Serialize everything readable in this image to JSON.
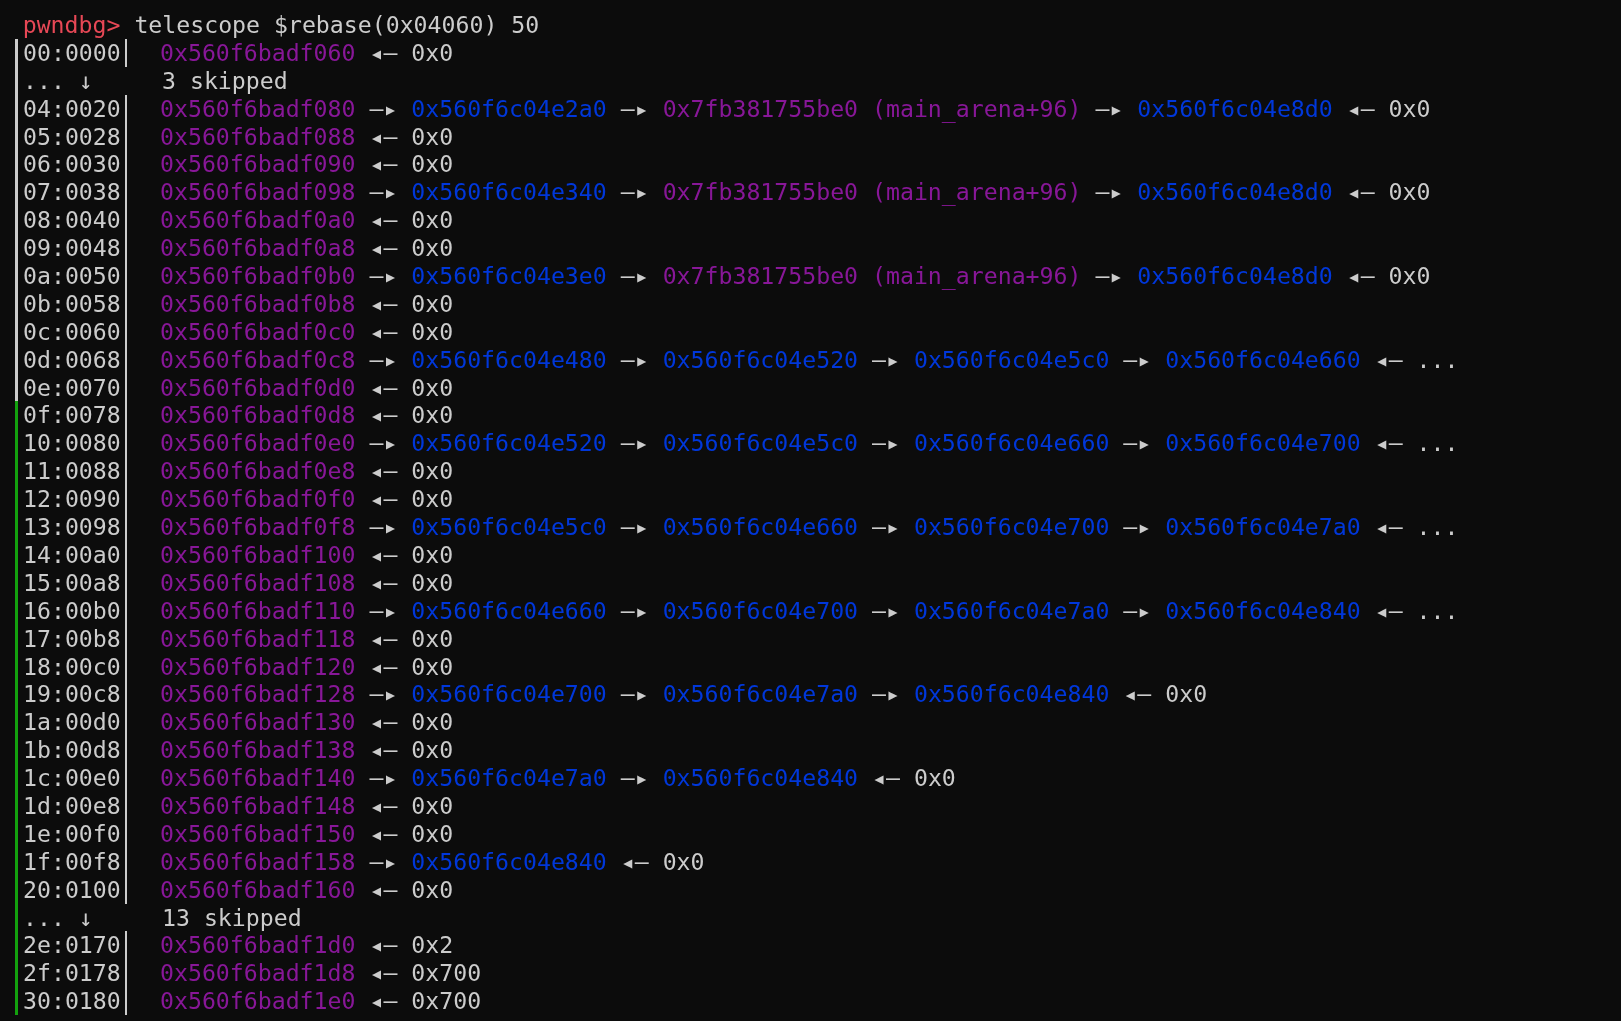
{
  "prompt": {
    "label": "pwndbg>",
    "command": "telescope $rebase(0x04060) 50"
  },
  "rows": [
    {
      "kind": "entry",
      "color": "#cccccc",
      "index": "00:0000",
      "chain": [
        {
          "text": "0x560f6badf060",
          "kind": "address"
        },
        {
          "text": "◂—",
          "kind": "arrow"
        },
        {
          "text": "0x0",
          "kind": "value"
        }
      ]
    },
    {
      "kind": "skip",
      "color": "#cccccc",
      "marker": "... ↓",
      "text": "3 skipped"
    },
    {
      "kind": "entry",
      "color": "#cccccc",
      "index": "04:0020",
      "chain": [
        {
          "text": "0x560f6badf080",
          "kind": "address"
        },
        {
          "text": "—▸",
          "kind": "arrow"
        },
        {
          "text": "0x560f6c04e2a0",
          "kind": "heap"
        },
        {
          "text": "—▸",
          "kind": "arrow"
        },
        {
          "text": "0x7fb381755be0 (main_arena+96)",
          "kind": "libc"
        },
        {
          "text": "—▸",
          "kind": "arrow"
        },
        {
          "text": "0x560f6c04e8d0",
          "kind": "heap"
        },
        {
          "text": "◂—",
          "kind": "arrow"
        },
        {
          "text": "0x0",
          "kind": "value"
        }
      ]
    },
    {
      "kind": "entry",
      "color": "#cccccc",
      "index": "05:0028",
      "chain": [
        {
          "text": "0x560f6badf088",
          "kind": "address"
        },
        {
          "text": "◂—",
          "kind": "arrow"
        },
        {
          "text": "0x0",
          "kind": "value"
        }
      ]
    },
    {
      "kind": "entry",
      "color": "#cccccc",
      "index": "06:0030",
      "chain": [
        {
          "text": "0x560f6badf090",
          "kind": "address"
        },
        {
          "text": "◂—",
          "kind": "arrow"
        },
        {
          "text": "0x0",
          "kind": "value"
        }
      ]
    },
    {
      "kind": "entry",
      "color": "#cccccc",
      "index": "07:0038",
      "chain": [
        {
          "text": "0x560f6badf098",
          "kind": "address"
        },
        {
          "text": "—▸",
          "kind": "arrow"
        },
        {
          "text": "0x560f6c04e340",
          "kind": "heap"
        },
        {
          "text": "—▸",
          "kind": "arrow"
        },
        {
          "text": "0x7fb381755be0 (main_arena+96)",
          "kind": "libc"
        },
        {
          "text": "—▸",
          "kind": "arrow"
        },
        {
          "text": "0x560f6c04e8d0",
          "kind": "heap"
        },
        {
          "text": "◂—",
          "kind": "arrow"
        },
        {
          "text": "0x0",
          "kind": "value"
        }
      ]
    },
    {
      "kind": "entry",
      "color": "#cccccc",
      "index": "08:0040",
      "chain": [
        {
          "text": "0x560f6badf0a0",
          "kind": "address"
        },
        {
          "text": "◂—",
          "kind": "arrow"
        },
        {
          "text": "0x0",
          "kind": "value"
        }
      ]
    },
    {
      "kind": "entry",
      "color": "#cccccc",
      "index": "09:0048",
      "chain": [
        {
          "text": "0x560f6badf0a8",
          "kind": "address"
        },
        {
          "text": "◂—",
          "kind": "arrow"
        },
        {
          "text": "0x0",
          "kind": "value"
        }
      ]
    },
    {
      "kind": "entry",
      "color": "#cccccc",
      "index": "0a:0050",
      "chain": [
        {
          "text": "0x560f6badf0b0",
          "kind": "address"
        },
        {
          "text": "—▸",
          "kind": "arrow"
        },
        {
          "text": "0x560f6c04e3e0",
          "kind": "heap"
        },
        {
          "text": "—▸",
          "kind": "arrow"
        },
        {
          "text": "0x7fb381755be0 (main_arena+96)",
          "kind": "libc"
        },
        {
          "text": "—▸",
          "kind": "arrow"
        },
        {
          "text": "0x560f6c04e8d0",
          "kind": "heap"
        },
        {
          "text": "◂—",
          "kind": "arrow"
        },
        {
          "text": "0x0",
          "kind": "value"
        }
      ]
    },
    {
      "kind": "entry",
      "color": "#cccccc",
      "index": "0b:0058",
      "chain": [
        {
          "text": "0x560f6badf0b8",
          "kind": "address"
        },
        {
          "text": "◂—",
          "kind": "arrow"
        },
        {
          "text": "0x0",
          "kind": "value"
        }
      ]
    },
    {
      "kind": "entry",
      "color": "#cccccc",
      "index": "0c:0060",
      "chain": [
        {
          "text": "0x560f6badf0c0",
          "kind": "address"
        },
        {
          "text": "◂—",
          "kind": "arrow"
        },
        {
          "text": "0x0",
          "kind": "value"
        }
      ]
    },
    {
      "kind": "entry",
      "color": "#cccccc",
      "index": "0d:0068",
      "chain": [
        {
          "text": "0x560f6badf0c8",
          "kind": "address"
        },
        {
          "text": "—▸",
          "kind": "arrow"
        },
        {
          "text": "0x560f6c04e480",
          "kind": "heap"
        },
        {
          "text": "—▸",
          "kind": "arrow"
        },
        {
          "text": "0x560f6c04e520",
          "kind": "heap"
        },
        {
          "text": "—▸",
          "kind": "arrow"
        },
        {
          "text": "0x560f6c04e5c0",
          "kind": "heap"
        },
        {
          "text": "—▸",
          "kind": "arrow"
        },
        {
          "text": "0x560f6c04e660",
          "kind": "heap"
        },
        {
          "text": "◂—",
          "kind": "arrow"
        },
        {
          "text": "...",
          "kind": "value"
        }
      ]
    },
    {
      "kind": "entry",
      "color": "#cccccc",
      "index": "0e:0070",
      "chain": [
        {
          "text": "0x560f6badf0d0",
          "kind": "address"
        },
        {
          "text": "◂—",
          "kind": "arrow"
        },
        {
          "text": "0x0",
          "kind": "value"
        }
      ]
    },
    {
      "kind": "entry",
      "color": "#13a10e",
      "index": "0f:0078",
      "chain": [
        {
          "text": "0x560f6badf0d8",
          "kind": "address"
        },
        {
          "text": "◂—",
          "kind": "arrow"
        },
        {
          "text": "0x0",
          "kind": "value"
        }
      ]
    },
    {
      "kind": "entry",
      "color": "#13a10e",
      "index": "10:0080",
      "chain": [
        {
          "text": "0x560f6badf0e0",
          "kind": "address"
        },
        {
          "text": "—▸",
          "kind": "arrow"
        },
        {
          "text": "0x560f6c04e520",
          "kind": "heap"
        },
        {
          "text": "—▸",
          "kind": "arrow"
        },
        {
          "text": "0x560f6c04e5c0",
          "kind": "heap"
        },
        {
          "text": "—▸",
          "kind": "arrow"
        },
        {
          "text": "0x560f6c04e660",
          "kind": "heap"
        },
        {
          "text": "—▸",
          "kind": "arrow"
        },
        {
          "text": "0x560f6c04e700",
          "kind": "heap"
        },
        {
          "text": "◂—",
          "kind": "arrow"
        },
        {
          "text": "...",
          "kind": "value"
        }
      ]
    },
    {
      "kind": "entry",
      "color": "#13a10e",
      "index": "11:0088",
      "chain": [
        {
          "text": "0x560f6badf0e8",
          "kind": "address"
        },
        {
          "text": "◂—",
          "kind": "arrow"
        },
        {
          "text": "0x0",
          "kind": "value"
        }
      ]
    },
    {
      "kind": "entry",
      "color": "#13a10e",
      "index": "12:0090",
      "chain": [
        {
          "text": "0x560f6badf0f0",
          "kind": "address"
        },
        {
          "text": "◂—",
          "kind": "arrow"
        },
        {
          "text": "0x0",
          "kind": "value"
        }
      ]
    },
    {
      "kind": "entry",
      "color": "#13a10e",
      "index": "13:0098",
      "chain": [
        {
          "text": "0x560f6badf0f8",
          "kind": "address"
        },
        {
          "text": "—▸",
          "kind": "arrow"
        },
        {
          "text": "0x560f6c04e5c0",
          "kind": "heap"
        },
        {
          "text": "—▸",
          "kind": "arrow"
        },
        {
          "text": "0x560f6c04e660",
          "kind": "heap"
        },
        {
          "text": "—▸",
          "kind": "arrow"
        },
        {
          "text": "0x560f6c04e700",
          "kind": "heap"
        },
        {
          "text": "—▸",
          "kind": "arrow"
        },
        {
          "text": "0x560f6c04e7a0",
          "kind": "heap"
        },
        {
          "text": "◂—",
          "kind": "arrow"
        },
        {
          "text": "...",
          "kind": "value"
        }
      ]
    },
    {
      "kind": "entry",
      "color": "#13a10e",
      "index": "14:00a0",
      "chain": [
        {
          "text": "0x560f6badf100",
          "kind": "address"
        },
        {
          "text": "◂—",
          "kind": "arrow"
        },
        {
          "text": "0x0",
          "kind": "value"
        }
      ]
    },
    {
      "kind": "entry",
      "color": "#13a10e",
      "index": "15:00a8",
      "chain": [
        {
          "text": "0x560f6badf108",
          "kind": "address"
        },
        {
          "text": "◂—",
          "kind": "arrow"
        },
        {
          "text": "0x0",
          "kind": "value"
        }
      ]
    },
    {
      "kind": "entry",
      "color": "#13a10e",
      "index": "16:00b0",
      "chain": [
        {
          "text": "0x560f6badf110",
          "kind": "address"
        },
        {
          "text": "—▸",
          "kind": "arrow"
        },
        {
          "text": "0x560f6c04e660",
          "kind": "heap"
        },
        {
          "text": "—▸",
          "kind": "arrow"
        },
        {
          "text": "0x560f6c04e700",
          "kind": "heap"
        },
        {
          "text": "—▸",
          "kind": "arrow"
        },
        {
          "text": "0x560f6c04e7a0",
          "kind": "heap"
        },
        {
          "text": "—▸",
          "kind": "arrow"
        },
        {
          "text": "0x560f6c04e840",
          "kind": "heap"
        },
        {
          "text": "◂—",
          "kind": "arrow"
        },
        {
          "text": "...",
          "kind": "value"
        }
      ]
    },
    {
      "kind": "entry",
      "color": "#13a10e",
      "index": "17:00b8",
      "chain": [
        {
          "text": "0x560f6badf118",
          "kind": "address"
        },
        {
          "text": "◂—",
          "kind": "arrow"
        },
        {
          "text": "0x0",
          "kind": "value"
        }
      ]
    },
    {
      "kind": "entry",
      "color": "#13a10e",
      "index": "18:00c0",
      "chain": [
        {
          "text": "0x560f6badf120",
          "kind": "address"
        },
        {
          "text": "◂—",
          "kind": "arrow"
        },
        {
          "text": "0x0",
          "kind": "value"
        }
      ]
    },
    {
      "kind": "entry",
      "color": "#13a10e",
      "index": "19:00c8",
      "chain": [
        {
          "text": "0x560f6badf128",
          "kind": "address"
        },
        {
          "text": "—▸",
          "kind": "arrow"
        },
        {
          "text": "0x560f6c04e700",
          "kind": "heap"
        },
        {
          "text": "—▸",
          "kind": "arrow"
        },
        {
          "text": "0x560f6c04e7a0",
          "kind": "heap"
        },
        {
          "text": "—▸",
          "kind": "arrow"
        },
        {
          "text": "0x560f6c04e840",
          "kind": "heap"
        },
        {
          "text": "◂—",
          "kind": "arrow"
        },
        {
          "text": "0x0",
          "kind": "value"
        }
      ]
    },
    {
      "kind": "entry",
      "color": "#13a10e",
      "index": "1a:00d0",
      "chain": [
        {
          "text": "0x560f6badf130",
          "kind": "address"
        },
        {
          "text": "◂—",
          "kind": "arrow"
        },
        {
          "text": "0x0",
          "kind": "value"
        }
      ]
    },
    {
      "kind": "entry",
      "color": "#13a10e",
      "index": "1b:00d8",
      "chain": [
        {
          "text": "0x560f6badf138",
          "kind": "address"
        },
        {
          "text": "◂—",
          "kind": "arrow"
        },
        {
          "text": "0x0",
          "kind": "value"
        }
      ]
    },
    {
      "kind": "entry",
      "color": "#13a10e",
      "index": "1c:00e0",
      "chain": [
        {
          "text": "0x560f6badf140",
          "kind": "address"
        },
        {
          "text": "—▸",
          "kind": "arrow"
        },
        {
          "text": "0x560f6c04e7a0",
          "kind": "heap"
        },
        {
          "text": "—▸",
          "kind": "arrow"
        },
        {
          "text": "0x560f6c04e840",
          "kind": "heap"
        },
        {
          "text": "◂—",
          "kind": "arrow"
        },
        {
          "text": "0x0",
          "kind": "value"
        }
      ]
    },
    {
      "kind": "entry",
      "color": "#13a10e",
      "index": "1d:00e8",
      "chain": [
        {
          "text": "0x560f6badf148",
          "kind": "address"
        },
        {
          "text": "◂—",
          "kind": "arrow"
        },
        {
          "text": "0x0",
          "kind": "value"
        }
      ]
    },
    {
      "kind": "entry",
      "color": "#13a10e",
      "index": "1e:00f0",
      "chain": [
        {
          "text": "0x560f6badf150",
          "kind": "address"
        },
        {
          "text": "◂—",
          "kind": "arrow"
        },
        {
          "text": "0x0",
          "kind": "value"
        }
      ]
    },
    {
      "kind": "entry",
      "color": "#13a10e",
      "index": "1f:00f8",
      "chain": [
        {
          "text": "0x560f6badf158",
          "kind": "address"
        },
        {
          "text": "—▸",
          "kind": "arrow"
        },
        {
          "text": "0x560f6c04e840",
          "kind": "heap"
        },
        {
          "text": "◂—",
          "kind": "arrow"
        },
        {
          "text": "0x0",
          "kind": "value"
        }
      ]
    },
    {
      "kind": "entry",
      "color": "#13a10e",
      "index": "20:0100",
      "chain": [
        {
          "text": "0x560f6badf160",
          "kind": "address"
        },
        {
          "text": "◂—",
          "kind": "arrow"
        },
        {
          "text": "0x0",
          "kind": "value"
        }
      ]
    },
    {
      "kind": "skip",
      "color": "#13a10e",
      "marker": "... ↓",
      "text": "13 skipped"
    },
    {
      "kind": "entry",
      "color": "#13a10e",
      "index": "2e:0170",
      "chain": [
        {
          "text": "0x560f6badf1d0",
          "kind": "address"
        },
        {
          "text": "◂—",
          "kind": "arrow"
        },
        {
          "text": "0x2",
          "kind": "value"
        }
      ]
    },
    {
      "kind": "entry",
      "color": "#13a10e",
      "index": "2f:0178",
      "chain": [
        {
          "text": "0x560f6badf1d8",
          "kind": "address"
        },
        {
          "text": "◂—",
          "kind": "arrow"
        },
        {
          "text": "0x700",
          "kind": "value"
        }
      ]
    },
    {
      "kind": "entry",
      "color": "#13a10e",
      "index": "30:0180",
      "chain": [
        {
          "text": "0x560f6badf1e0",
          "kind": "address"
        },
        {
          "text": "◂—",
          "kind": "arrow"
        },
        {
          "text": "0x700",
          "kind": "value"
        }
      ]
    }
  ]
}
